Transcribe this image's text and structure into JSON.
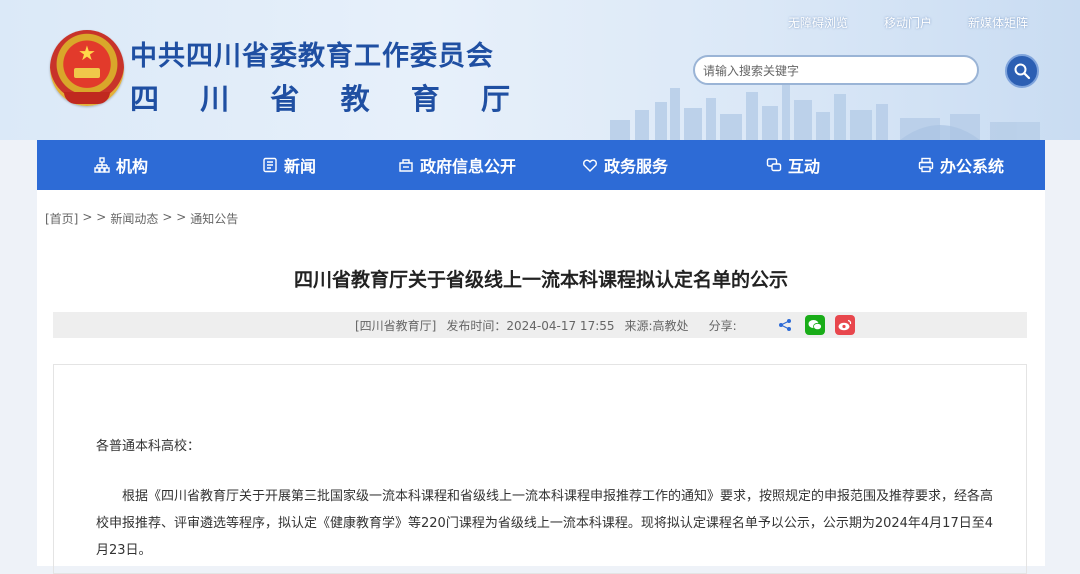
{
  "header": {
    "title_top": "中共四川省委教育工作委员会",
    "title_bottom_chars": [
      "四",
      "川",
      "省",
      "教",
      "育",
      "厅"
    ],
    "links": [
      "无障碍浏览",
      "移动门户",
      "新媒体矩阵"
    ]
  },
  "search": {
    "placeholder": "请输入搜索关键字"
  },
  "nav": [
    {
      "label": "机构",
      "icon": "org-icon"
    },
    {
      "label": "新闻",
      "icon": "news-icon"
    },
    {
      "label": "政府信息公开",
      "icon": "info-open-icon"
    },
    {
      "label": "政务服务",
      "icon": "service-icon"
    },
    {
      "label": "互动",
      "icon": "interact-icon"
    },
    {
      "label": "办公系统",
      "icon": "office-icon"
    }
  ],
  "breadcrumb": {
    "home": "[首页]",
    "sep": "> >",
    "level1": "新闻动态",
    "level2": "通知公告"
  },
  "article": {
    "title": "四川省教育厅关于省级线上一流本科课程拟认定名单的公示",
    "source": "[四川省教育厅]",
    "published": "发布时间：2024-04-17 17:55",
    "origin": "来源:高教处",
    "share_label": "分享:",
    "salutation": "各普通本科高校：",
    "paragraph": "根据《四川省教育厅关于开展第三批国家级一流本科课程和省级线上一流本科课程申报推荐工作的通知》要求，按照规定的申报范围及推荐要求，经各高校申报推荐、评审遴选等程序，拟认定《健康教育学》等220门课程为省级线上一流本科课程。现将拟认定课程名单予以公示，公示期为2024年4月17日至4月23日。"
  },
  "colors": {
    "nav_bg": "#2d6bd6",
    "title_blue": "#1f4fa2",
    "wechat": "#1aad19",
    "weibo": "#e8474d"
  }
}
